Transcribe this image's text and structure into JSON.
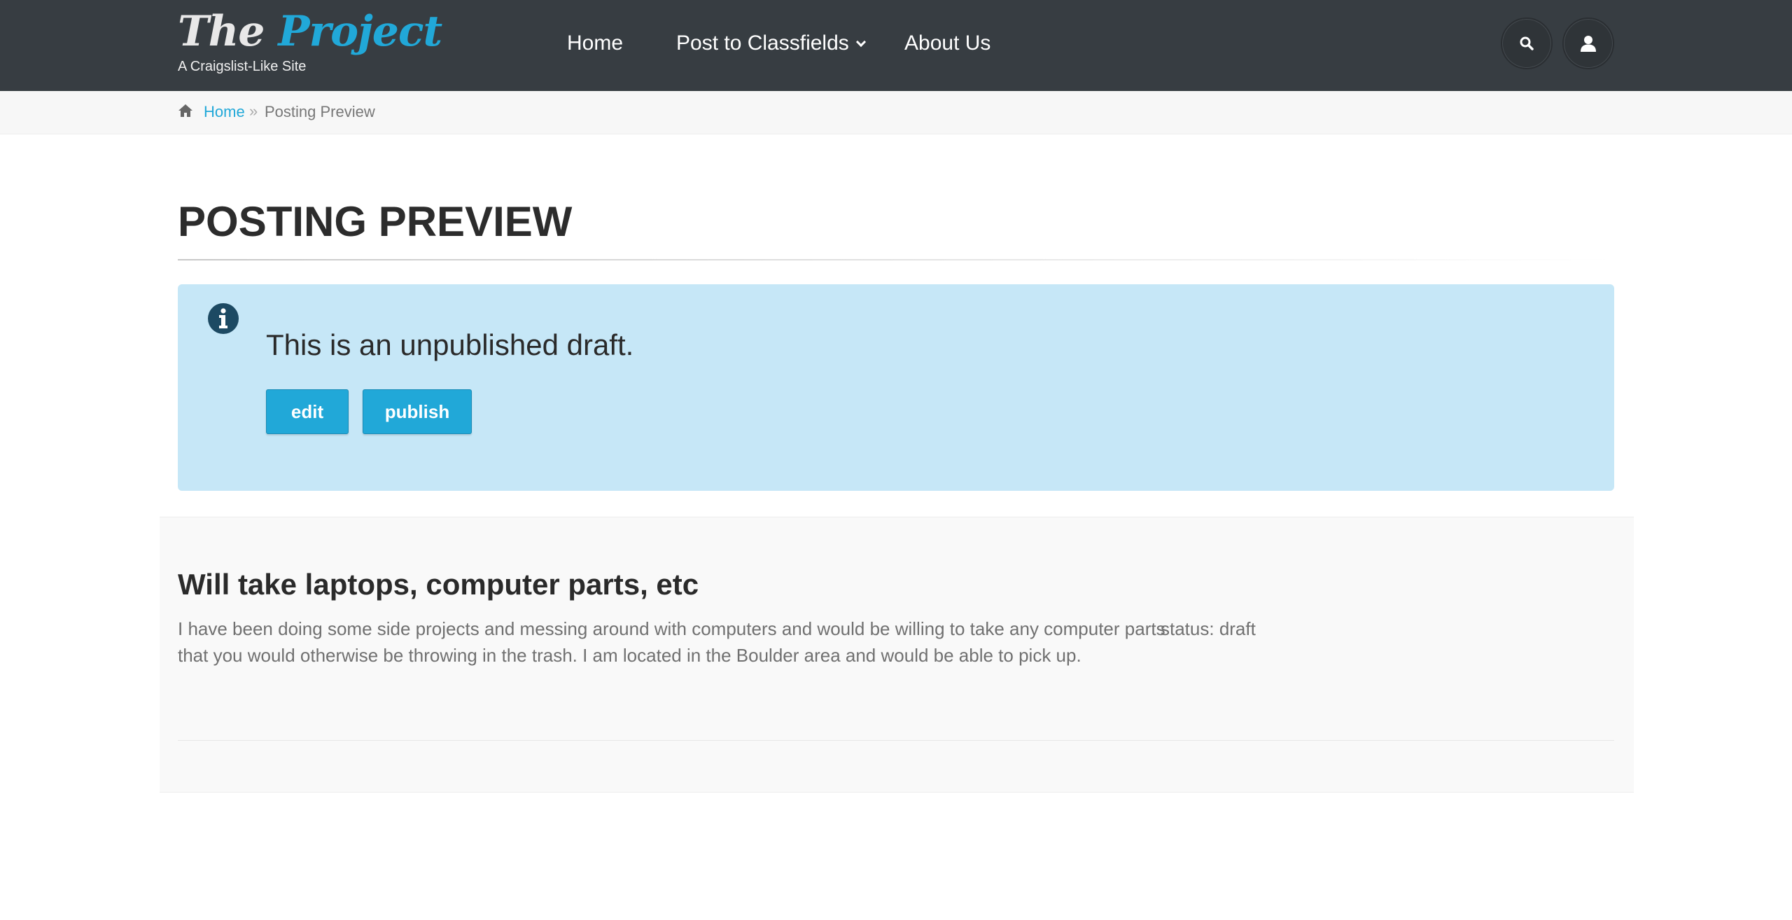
{
  "header": {
    "logo_the": "The",
    "logo_project": "Project",
    "tagline": "A Craigslist-Like Site",
    "nav": {
      "home": "Home",
      "post": "Post to Classfields",
      "about": "About Us"
    },
    "icons": {
      "search": "search-icon",
      "user": "user-icon",
      "dropdown": "chevron-down-icon"
    }
  },
  "breadcrumb": {
    "home_icon": "home-icon",
    "home": "Home",
    "separator": "»",
    "current": "Posting Preview"
  },
  "page": {
    "title": "POSTING PREVIEW"
  },
  "alert": {
    "icon": "info-icon",
    "message": "This is an unpublished draft.",
    "edit_label": "edit",
    "publish_label": "publish"
  },
  "posting": {
    "title": "Will take laptops, computer parts, etc",
    "body": "I have been doing some side projects and messing around with computers and would be willing to take any computer parts that you would otherwise be throwing in the trash. I am located in the Boulder area and would be able to pick up.",
    "status": "status: draft"
  },
  "colors": {
    "header_bg": "#373d42",
    "accent": "#21a8d8",
    "alert_bg": "#c6e7f7",
    "breadcrumb_bg": "#f7f7f7",
    "section_bg": "#f9f9f9"
  }
}
